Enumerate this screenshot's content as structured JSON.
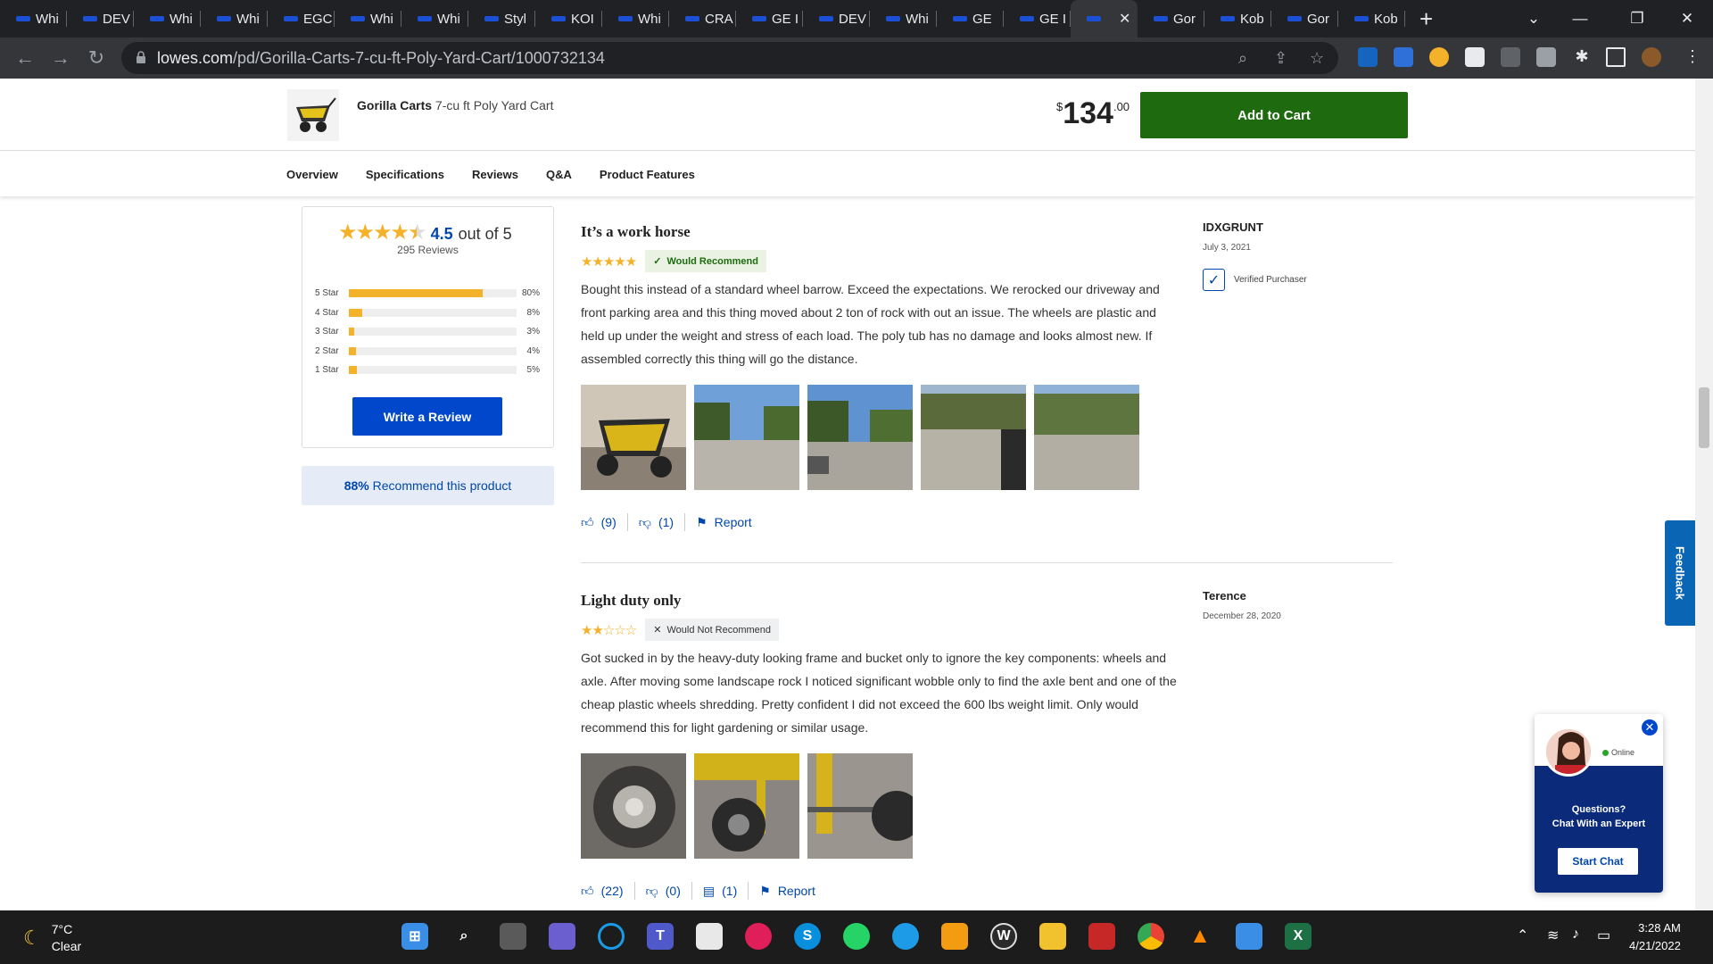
{
  "browser": {
    "tabs": [
      "Whi",
      "DEV",
      "Whi",
      "Whi",
      "EGC",
      "Whi",
      "Whi",
      "Styl",
      "KOI",
      "Whi",
      "CRA",
      "GE I",
      "DEV",
      "Whi",
      "GE",
      "GE I",
      "",
      "Gor",
      "Kob",
      "Gor",
      "Kob"
    ],
    "url_domain": "lowes.com",
    "url_path": "/pd/Gorilla-Carts-7-cu-ft-Poly-Yard-Cart/1000732134"
  },
  "product": {
    "brand": "Gorilla Carts",
    "name": "7-cu ft Poly Yard Cart",
    "price_currency": "$",
    "price_whole": "134",
    "price_cents": ".00",
    "add_to_cart": "Add to Cart"
  },
  "subnav": [
    "Overview",
    "Specifications",
    "Reviews",
    "Q&A",
    "Product Features"
  ],
  "summary": {
    "rating": "4.5",
    "out_of": "out of 5",
    "review_count": "295 Reviews",
    "histogram": [
      {
        "label": "5 Star",
        "pct": "80%",
        "value": 80
      },
      {
        "label": "4 Star",
        "pct": "8%",
        "value": 8
      },
      {
        "label": "3 Star",
        "pct": "3%",
        "value": 3
      },
      {
        "label": "2 Star",
        "pct": "4%",
        "value": 4
      },
      {
        "label": "1 Star",
        "pct": "5%",
        "value": 5
      }
    ],
    "write_review": "Write a Review",
    "recommend_pct": "88%",
    "recommend_text": "Recommend this product"
  },
  "reviews": [
    {
      "title": "It’s a work horse",
      "stars": "★★★★★",
      "badge": "Would Recommend",
      "body": "Bought this instead of a standard wheel barrow. Exceed the expectations. We rerocked our driveway and front parking area and this thing moved about 2 ton of rock with out an issue. The wheels are plastic and held up under the weight and stress of each load. The poly tub has no damage and looks almost new. If assembled correctly this thing will go the distance.",
      "helpful": "(9)",
      "unhelpful": "(1)",
      "report": "Report",
      "author": "IDXGRUNT",
      "date": "July 3, 2021",
      "verified": "Verified Purchaser"
    },
    {
      "title": "Light duty only",
      "stars": "★★☆☆☆",
      "badge": "Would Not Recommend",
      "body": "Got sucked in by the heavy-duty looking frame and bucket only to ignore the key components: wheels and axle. After moving some landscape rock I noticed significant wobble only to find the axle bent and one of the cheap plastic wheels shredding. Pretty confident I did not exceed the 600 lbs weight limit. Only would recommend this for light gardening or similar usage.",
      "helpful": "(22)",
      "unhelpful": "(0)",
      "comments": "(1)",
      "report": "Report",
      "author": "Terence",
      "date": "December 28, 2020"
    }
  ],
  "feedback": "Feedback",
  "chat": {
    "status": "Online",
    "question": "Questions?",
    "subtitle": "Chat With an Expert",
    "button": "Start Chat"
  },
  "taskbar": {
    "temp": "7°C",
    "condition": "Clear",
    "time": "3:28 AM",
    "date": "4/21/2022"
  },
  "colors": {
    "add_to_cart": "#1e6b0f",
    "lowes_blue": "#0047cc",
    "star": "#f3b229"
  }
}
